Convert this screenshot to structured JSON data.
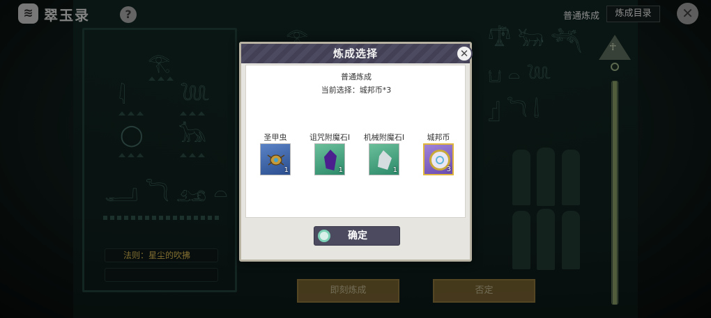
{
  "app": {
    "title": "翠玉录",
    "logo_glyph": "≋",
    "help_glyph": "?"
  },
  "nav": {
    "normal_refine": "普通炼成",
    "catalog": "炼成目录",
    "close_glyph": "✕"
  },
  "background": {
    "rule_text": "法则：星尘的吹拂",
    "buttons": {
      "instant": "即刻炼成",
      "deny": "否定"
    }
  },
  "modal": {
    "title": "炼成选择",
    "close_glyph": "✕",
    "mode": "普通炼成",
    "current_selection": "当前选择：城邦币*3",
    "items": [
      {
        "name": "圣甲虫",
        "count": "1",
        "icon": "scarab-icon",
        "tile": "blue"
      },
      {
        "name": "诅咒附魔石I",
        "count": "1",
        "icon": "purple-gem-icon",
        "tile": "green"
      },
      {
        "name": "机械附魔石I",
        "count": "1",
        "icon": "grey-crystal-icon",
        "tile": "green"
      },
      {
        "name": "城邦币",
        "count": "3",
        "icon": "city-coin-icon",
        "tile": "purple",
        "selected": true
      }
    ],
    "confirm": "确定"
  },
  "colors": {
    "accent": "#4b4a5e",
    "selected_border": "#e0b73c",
    "gold": "#c6a84a"
  }
}
